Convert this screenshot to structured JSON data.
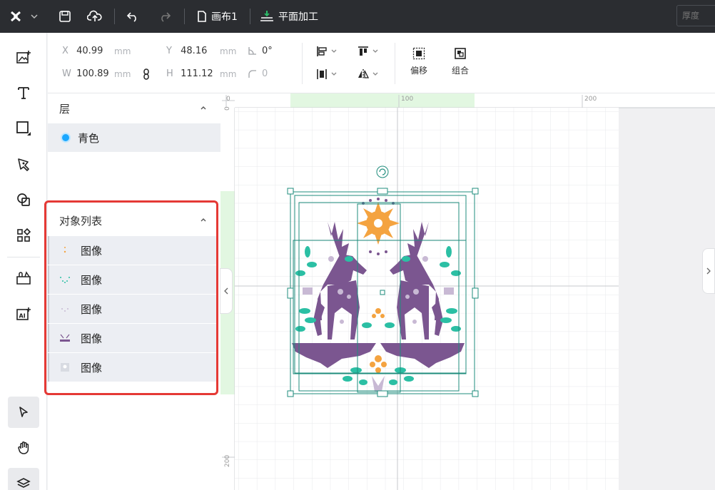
{
  "topbar": {
    "canvas_name": "画布1",
    "mode": "平面加工",
    "thickness_placeholder": "厚度"
  },
  "props": {
    "x_label": "X",
    "x_value": "40.99",
    "x_unit": "mm",
    "y_label": "Y",
    "y_value": "48.16",
    "y_unit": "mm",
    "rotation_value": "0°",
    "w_label": "W",
    "w_value": "100.89",
    "w_unit": "mm",
    "h_label": "H",
    "h_value": "111.12",
    "h_unit": "mm",
    "corner_value": "0",
    "offset_label": "偏移",
    "group_label": "组合"
  },
  "layers": {
    "title": "层",
    "items": [
      {
        "label": "青色",
        "color": "#1aa7ff"
      }
    ]
  },
  "objects": {
    "title": "对象列表",
    "items": [
      {
        "label": "图像"
      },
      {
        "label": "图像"
      },
      {
        "label": "图像"
      },
      {
        "label": "图像"
      },
      {
        "label": "图像"
      }
    ]
  },
  "ruler": {
    "h_labels": [
      "0",
      "100",
      "200"
    ],
    "v_labels": [
      "0",
      "200"
    ]
  },
  "colors": {
    "accent": "#1aa7ff",
    "purple": "#7b5690",
    "teal": "#2bbfa4",
    "orange": "#f4a340",
    "selection": "#1f8c7c",
    "highlight": "#e53935"
  }
}
